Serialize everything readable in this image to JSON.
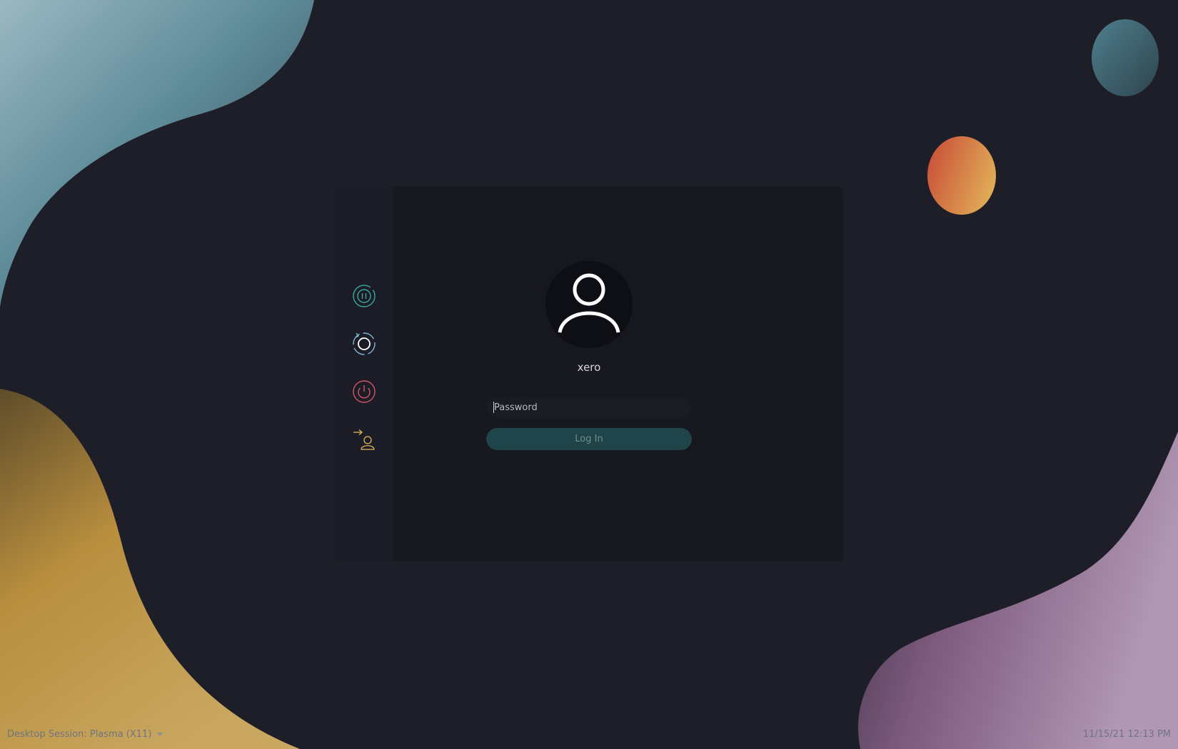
{
  "user": {
    "name": "xero"
  },
  "password_field": {
    "placeholder": "Password"
  },
  "login_button": {
    "label": "Log In"
  },
  "actions": [
    {
      "name": "suspend",
      "icon": "suspend-icon",
      "color": "#3aa7a0"
    },
    {
      "name": "restart",
      "icon": "restart-icon",
      "color": "#7fb8d6"
    },
    {
      "name": "shutdown",
      "icon": "power-icon",
      "color": "#d2556b"
    },
    {
      "name": "switch-user",
      "icon": "switch-user-icon",
      "color": "#e0b65a"
    }
  ],
  "footer": {
    "session_label": "Desktop Session: Plasma (X11)",
    "datetime": "11/15/21 12:13 PM"
  },
  "colors": {
    "background": "#1d1e27",
    "card": "#16171f",
    "accent": "#1f4449"
  }
}
